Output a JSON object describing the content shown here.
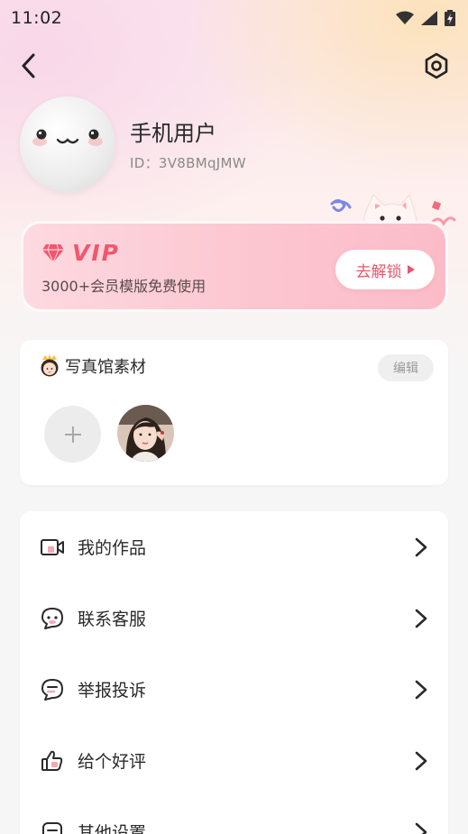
{
  "status_bar": {
    "time": "11:02"
  },
  "profile": {
    "name": "手机用户",
    "id_text": "ID：3V8BMqJMW"
  },
  "vip": {
    "title": "VIP",
    "description": "3000+会员模版免费使用",
    "unlock_label": "去解锁"
  },
  "materials": {
    "title": "写真馆素材",
    "edit_label": "编辑"
  },
  "menu": {
    "items": [
      {
        "label": "我的作品",
        "icon": "video-camera-icon"
      },
      {
        "label": "联系客服",
        "icon": "customer-service-icon"
      },
      {
        "label": "举报投诉",
        "icon": "report-chat-icon"
      },
      {
        "label": "给个好评",
        "icon": "thumbs-up-icon"
      },
      {
        "label": "其他设置",
        "icon": "other-settings-icon"
      }
    ]
  },
  "colors": {
    "accent": "#f2566e",
    "vip_bg": "#fcc6d0",
    "text_primary": "#2a2a2a",
    "text_secondary": "#8a8a8a"
  }
}
